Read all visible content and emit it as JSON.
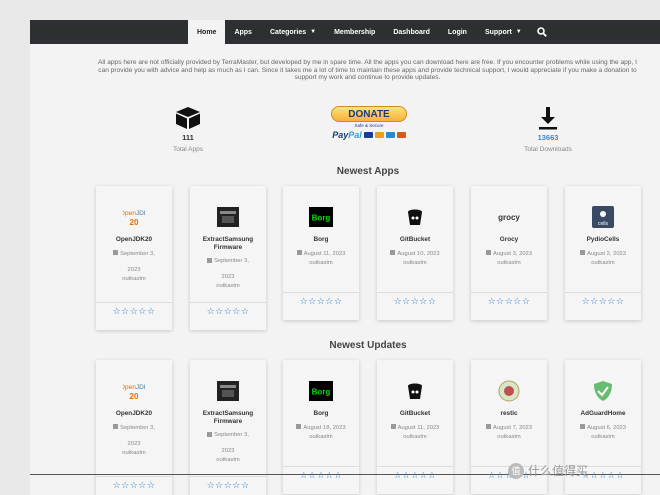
{
  "nav": {
    "items": [
      {
        "label": "Home",
        "active": true
      },
      {
        "label": "Apps"
      },
      {
        "label": "Categories",
        "caret": true
      },
      {
        "label": "Membership"
      },
      {
        "label": "Dashboard"
      },
      {
        "label": "Login"
      },
      {
        "label": "Support",
        "caret": true
      }
    ],
    "search_icon": "search-icon"
  },
  "intro": "All apps here are not officially provided by TerraMaster, but developed by me in spare time. All the apps you can download here are free. If you encounter problems while using the app, I can provide you with advice and help as much as I can. Since it takes me a lot of time to maintain these apps and provide technical support, I would appreciate if you make a donation to support my work and continue to provide updates.",
  "stats": {
    "apps_count": "111",
    "apps_label": "Total Apps",
    "downloads_count": "13663",
    "downloads_label": "Total Downloads"
  },
  "donate": {
    "button": "DONATE",
    "sub": "Safe & Secure",
    "paypal_a": "Pay",
    "paypal_b": "Pal"
  },
  "sections": {
    "newest_apps": "Newest Apps",
    "newest_updates": "Newest Updates"
  },
  "stars": "☆☆☆☆☆",
  "newest_apps": [
    {
      "name": "OpenJDK20",
      "date1": "September 3,",
      "date2": "2023",
      "author": "outkastm",
      "logo": "openjdk"
    },
    {
      "name": "ExtractSamsung Firmware",
      "date1": "September 3,",
      "date2": "2023",
      "author": "outkastm",
      "logo": "samsung"
    },
    {
      "name": "Borg",
      "date1": "August 11, 2023",
      "date2": "",
      "author": "outkastm",
      "logo": "borg"
    },
    {
      "name": "GitBucket",
      "date1": "August 10, 2023",
      "date2": "",
      "author": "outkastm",
      "logo": "gitbucket"
    },
    {
      "name": "Grocy",
      "date1": "August 3, 2023",
      "date2": "",
      "author": "outkastm",
      "logo": "grocy"
    },
    {
      "name": "PydioCells",
      "date1": "August 2, 2023",
      "date2": "",
      "author": "outkastm",
      "logo": "pydio"
    }
  ],
  "newest_updates": [
    {
      "name": "OpenJDK20",
      "date1": "September 3,",
      "date2": "2023",
      "author": "outkastm",
      "logo": "openjdk"
    },
    {
      "name": "ExtractSamsung Firmware",
      "date1": "September 3,",
      "date2": "2023",
      "author": "outkastm",
      "logo": "samsung"
    },
    {
      "name": "Borg",
      "date1": "August 18, 2023",
      "date2": "",
      "author": "outkastm",
      "logo": "borg"
    },
    {
      "name": "GitBucket",
      "date1": "August 11, 2023",
      "date2": "",
      "author": "outkastm",
      "logo": "gitbucket"
    },
    {
      "name": "restic",
      "date1": "August 7, 2023",
      "date2": "",
      "author": "outkastm",
      "logo": "restic"
    },
    {
      "name": "AdGuardHome",
      "date1": "August 6, 2023",
      "date2": "",
      "author": "outkastm",
      "logo": "adguard"
    }
  ],
  "watermark": "什么值得买",
  "colors": {
    "nav_bg": "#2d2f33",
    "accent": "#2a79c8",
    "downloads": "#3a8ad0"
  }
}
